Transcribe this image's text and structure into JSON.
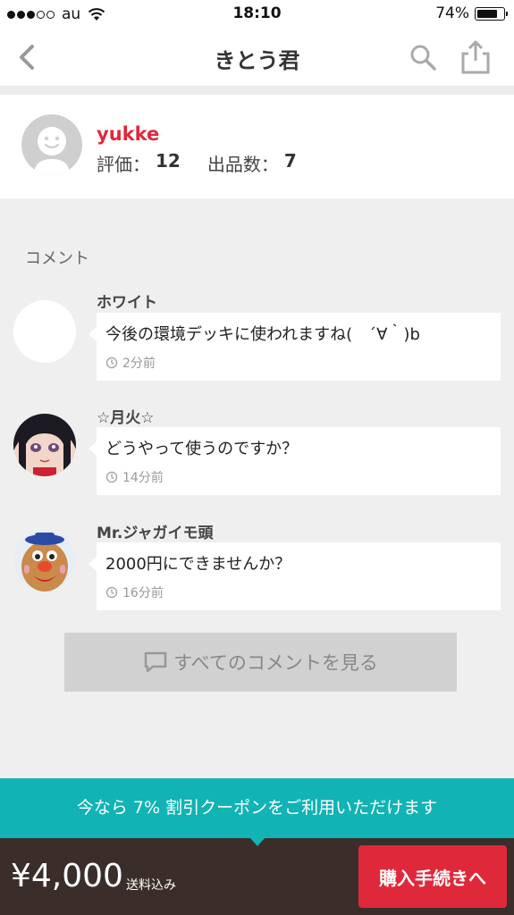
{
  "status_bar": {
    "carrier": "au",
    "time": "18:10",
    "battery": "74%"
  },
  "nav": {
    "title": "きとう君"
  },
  "seller": {
    "name": "yukke",
    "rating_label": "評価：",
    "rating_value": "12",
    "listings_label": "出品数：",
    "listings_value": "7"
  },
  "comments_label": "コメント",
  "comments": [
    {
      "user": "ホワイト",
      "text": "今後の環境デッキに使われますね(　´∀｀)b",
      "time": "2分前",
      "avatar": "blank-avatar"
    },
    {
      "user": "☆月火☆",
      "text": "どうやって使うのですか？",
      "time": "14分前",
      "avatar": "anime-girl-avatar"
    },
    {
      "user": "Mr.ジャガイモ頭",
      "text": "2000円にできませんか？",
      "time": "16分前",
      "avatar": "potato-head-avatar"
    }
  ],
  "all_comments_button": "すべてのコメントを見る",
  "coupon_banner": "今なら 7% 割引クーポンをご利用いただけます",
  "footer": {
    "price": "¥4,000",
    "shipping": "送料込み",
    "buy_button": "購入手続きへ"
  },
  "colors": {
    "accent_red": "#e0283b",
    "teal": "#11b3b4",
    "footer_bg": "#3b2e2a"
  }
}
